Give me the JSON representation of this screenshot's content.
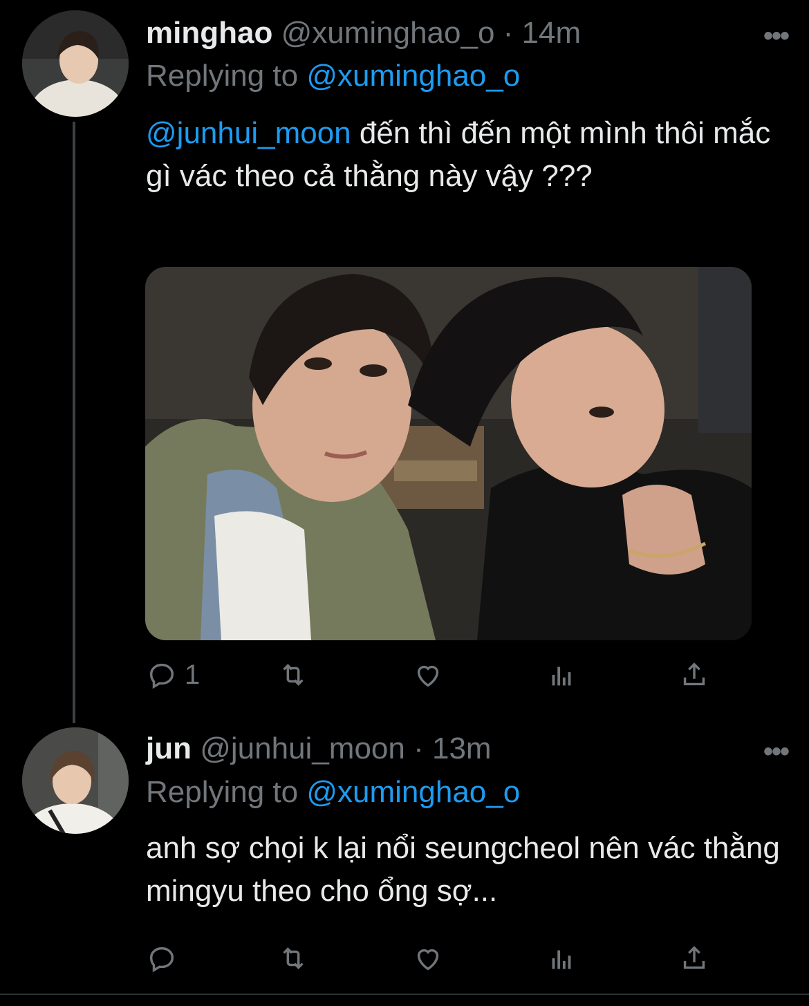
{
  "tweets": [
    {
      "name": "minghao",
      "handle": "@xuminghao_o",
      "separator": "·",
      "time": "14m",
      "replying_prefix": "Replying to ",
      "replying_to": "@xuminghao_o",
      "mention": "@junhui_moon",
      "text": " đến thì đến một mình thôi mắc gì vác theo cả thằng này vậy ???",
      "more_label": "•••",
      "actions": {
        "reply_count": "1"
      }
    },
    {
      "name": "jun",
      "handle": "@junhui_moon",
      "separator": "·",
      "time": "13m",
      "replying_prefix": "Replying to ",
      "replying_to": "@xuminghao_o",
      "text": "anh sợ chọi k lại nổi seungcheol nên vác thằng mingyu theo cho ổng sợ...",
      "more_label": "•••",
      "actions": {
        "reply_count": ""
      }
    }
  ],
  "colors": {
    "background": "#000000",
    "accent": "#1d9bf0",
    "muted": "#71767b",
    "text": "#e7e9ea"
  },
  "icons": [
    "reply-icon",
    "retweet-icon",
    "like-icon",
    "analytics-icon",
    "share-icon",
    "more-icon"
  ]
}
